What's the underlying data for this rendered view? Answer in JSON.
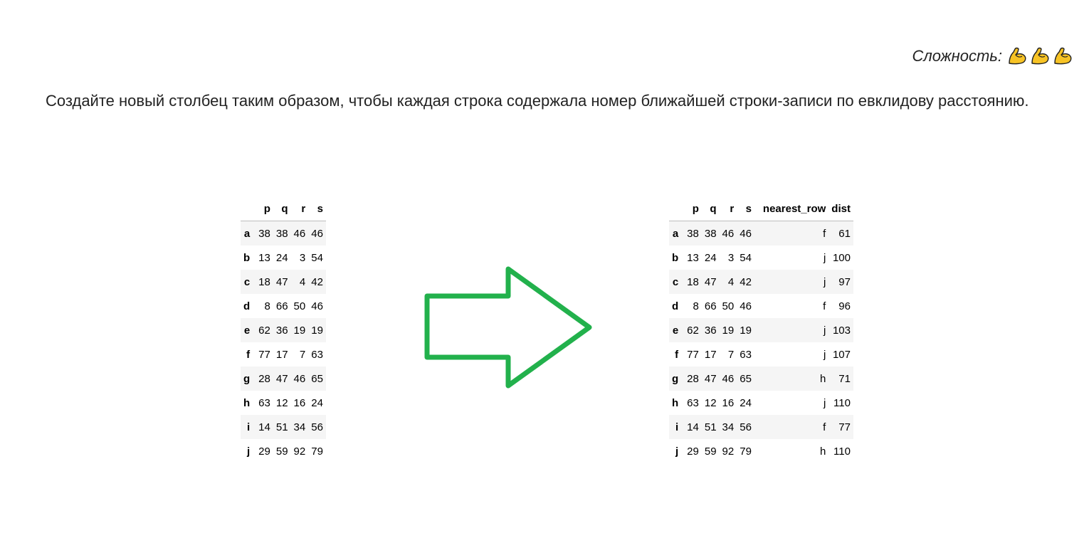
{
  "difficulty": {
    "label": "Сложность:",
    "level_icons": [
      "flexed-biceps-icon",
      "flexed-biceps-icon",
      "flexed-biceps-icon"
    ]
  },
  "task_text": "Создайте новый столбец таким образом, чтобы каждая строка содержала номер ближайшей строки-записи по евклидову расстоянию.",
  "arrow_color": "#22b14c",
  "left_table": {
    "columns": [
      "",
      "p",
      "q",
      "r",
      "s"
    ],
    "rows": [
      [
        "a",
        "38",
        "38",
        "46",
        "46"
      ],
      [
        "b",
        "13",
        "24",
        "3",
        "54"
      ],
      [
        "c",
        "18",
        "47",
        "4",
        "42"
      ],
      [
        "d",
        "8",
        "66",
        "50",
        "46"
      ],
      [
        "e",
        "62",
        "36",
        "19",
        "19"
      ],
      [
        "f",
        "77",
        "17",
        "7",
        "63"
      ],
      [
        "g",
        "28",
        "47",
        "46",
        "65"
      ],
      [
        "h",
        "63",
        "12",
        "16",
        "24"
      ],
      [
        "i",
        "14",
        "51",
        "34",
        "56"
      ],
      [
        "j",
        "29",
        "59",
        "92",
        "79"
      ]
    ]
  },
  "right_table": {
    "columns": [
      "",
      "p",
      "q",
      "r",
      "s",
      "nearest_row",
      "dist"
    ],
    "rows": [
      [
        "a",
        "38",
        "38",
        "46",
        "46",
        "f",
        "61"
      ],
      [
        "b",
        "13",
        "24",
        "3",
        "54",
        "j",
        "100"
      ],
      [
        "c",
        "18",
        "47",
        "4",
        "42",
        "j",
        "97"
      ],
      [
        "d",
        "8",
        "66",
        "50",
        "46",
        "f",
        "96"
      ],
      [
        "e",
        "62",
        "36",
        "19",
        "19",
        "j",
        "103"
      ],
      [
        "f",
        "77",
        "17",
        "7",
        "63",
        "j",
        "107"
      ],
      [
        "g",
        "28",
        "47",
        "46",
        "65",
        "h",
        "71"
      ],
      [
        "h",
        "63",
        "12",
        "16",
        "24",
        "j",
        "110"
      ],
      [
        "i",
        "14",
        "51",
        "34",
        "56",
        "f",
        "77"
      ],
      [
        "j",
        "29",
        "59",
        "92",
        "79",
        "h",
        "110"
      ]
    ]
  }
}
